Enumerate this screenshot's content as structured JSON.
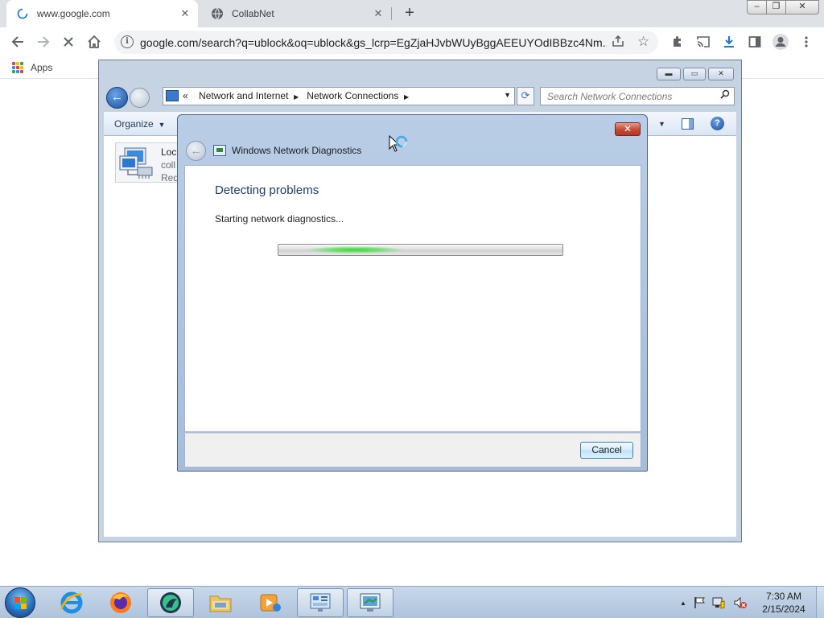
{
  "browser": {
    "tabs": [
      {
        "title": "www.google.com",
        "state": "loading"
      },
      {
        "title": "CollabNet",
        "state": "idle"
      }
    ],
    "tab_close_glyph": "✕",
    "new_tab_glyph": "+",
    "url": "google.com/search?q=ublock&oq=ublock&gs_lcrp=EgZjaHJvbWUyBggAEEUYOdIBBzc4Nm...",
    "bookmarks": {
      "apps_label": "Apps"
    },
    "icons": [
      "back-arrow-icon",
      "forward-arrow-icon",
      "home-icon",
      "stop-icon",
      "site-info-icon",
      "share-icon",
      "star-icon",
      "extensions-icon",
      "cast-icon",
      "download-icon",
      "side-panel-icon",
      "profile-icon",
      "more-menu-icon"
    ]
  },
  "explorer": {
    "breadcrumb": {
      "overflow": "«",
      "items": [
        "Network and Internet",
        "Network Connections"
      ]
    },
    "search_placeholder": "Search Network Connections",
    "organize_label": "Organize",
    "connection": {
      "name": "Loc",
      "line1": "coll",
      "line2": "Red"
    }
  },
  "dialog": {
    "title": "Windows Network Diagnostics",
    "heading": "Detecting problems",
    "status": "Starting network diagnostics...",
    "progress": "indeterminate",
    "cancel_label": "Cancel",
    "close_glyph": "✕"
  },
  "taskbar": {
    "apps": [
      "internet-explorer",
      "firefox",
      "app-circle",
      "file-explorer",
      "media-player",
      "control-panel",
      "network-diagnostics"
    ],
    "clock": {
      "time": "7:30 AM",
      "date": "2/15/2024"
    },
    "tray_expand_glyph": "▲"
  },
  "colors": {
    "chrome_tabstrip": "#dee1e6",
    "aero_frame": "#b9cde6",
    "dialog_heading": "#1f3b6b",
    "progress_glow": "#3cd43c"
  }
}
